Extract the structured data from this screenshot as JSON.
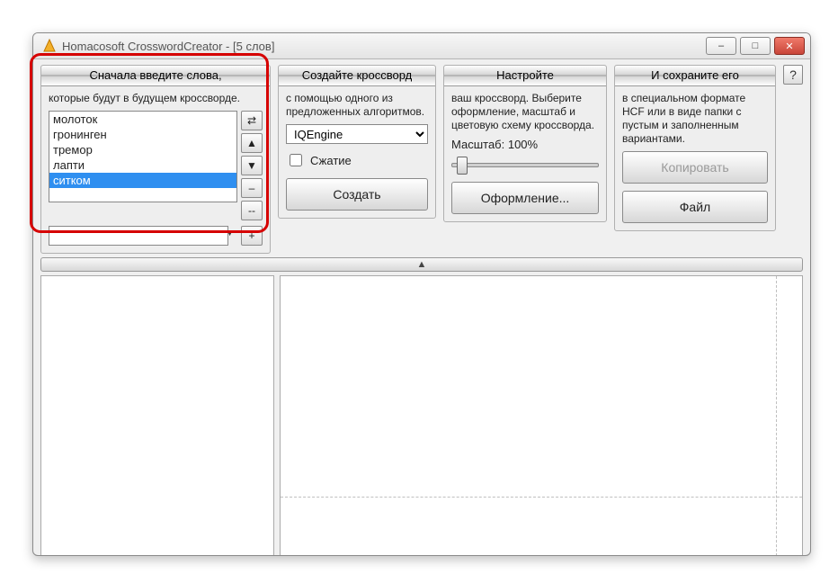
{
  "window": {
    "title": "Homacosoft CrosswordCreator - [5 слов]"
  },
  "panels": {
    "words": {
      "header": "Сначала введите слова,",
      "desc": "которые будут в будущем кроссворде."
    },
    "create": {
      "header": "Создайте кроссворд",
      "desc": "с помощью одного из предложенных алгоритмов.",
      "algo": "IQEngine",
      "compress": "Сжатие",
      "button": "Создать"
    },
    "settings": {
      "header": "Настройте",
      "desc": "ваш кроссворд. Выберите оформление, масштаб и цветовую схему кроссворда.",
      "scale_label": "Масштаб: 100%",
      "button": "Оформление..."
    },
    "save": {
      "header": "И сохраните его",
      "desc": "в специальном формате HCF или в виде папки с пустым и заполненным вариантами.",
      "copy_button": "Копировать",
      "file_button": "Файл"
    }
  },
  "words": [
    "молоток",
    "гронинген",
    "тремор",
    "лапти",
    "ситком"
  ],
  "side_buttons": {
    "sort": "⇄",
    "up": "▲",
    "down": "▼",
    "remove": "–",
    "remove2": "--",
    "add": "+"
  },
  "help": "?"
}
